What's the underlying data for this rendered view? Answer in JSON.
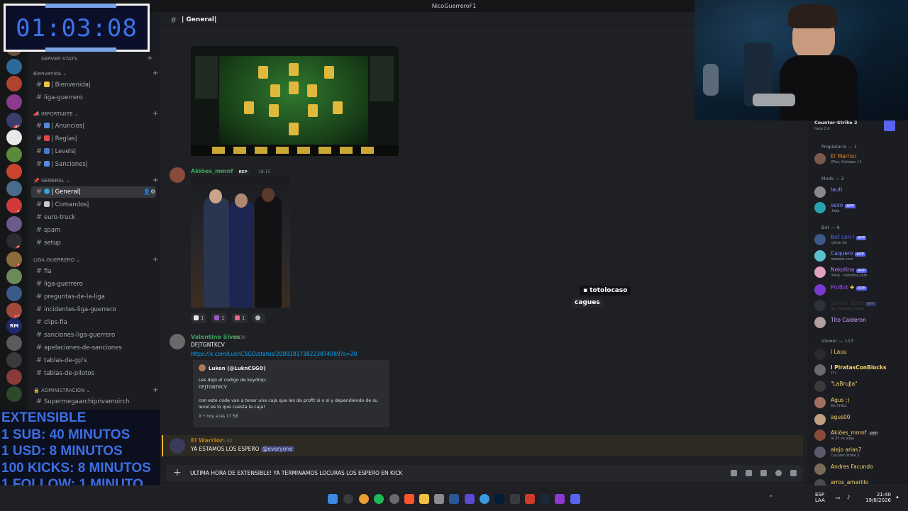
{
  "window_title": "NicoGuerreroF1",
  "timer": {
    "display": "01:03:08"
  },
  "extensible": {
    "lines": [
      "EXTENSIBLE",
      "1 SUB: 40 MINUTOS",
      "1 USD: 8 MINUTOS",
      "100 KICKS: 8 MINUTOS",
      "1 FOLLOW: 1 MINUTO"
    ]
  },
  "rail": {
    "badges": [
      "418",
      "59",
      "64",
      "31",
      "171"
    ],
    "rm_label": "RM"
  },
  "sidebar": {
    "server_stats": "SERVER STATS",
    "categories": {
      "bienvenida": "Bienvenida",
      "importante": "IMPORTANTE",
      "general": "GENERAL",
      "liga": "LIGA GUERRERO",
      "admin": "ADMINISTRACION"
    },
    "channels": {
      "bienvenida": "| Bienvenida|",
      "liga_guerrero": "liga-guerrero",
      "anuncios": "| Anuncios|",
      "reglas": "| Reglas|",
      "levels": "| Levels|",
      "sanciones": "| Sanciones|",
      "general": "| General|",
      "comandos": "| Comandos|",
      "euro_truck": "euro-truck",
      "spam": "spam",
      "setup": "setup",
      "fia": "fia",
      "liga_guerrero2": "liga-guerrero",
      "preguntas": "preguntas-de-la-liga",
      "incidentes": "incidentes-liga-guerrero",
      "clips": "clips-fia",
      "sanciones_liga": "sanciones-liga-guerrero",
      "apelaciones": "apelaciones-de-sanciones",
      "tablas_gp": "tablas-de-gp's",
      "tablas_pilotos": "tablas-de-pilotos",
      "super": "Supermegaarchiprivamoirch"
    }
  },
  "chat": {
    "header_title": "| General|",
    "messages": [
      {
        "author": "Akiões_mmnf",
        "badge": "REP",
        "time": "18:15",
        "author_color": "#3ba55c"
      },
      {
        "author": "Valentino Sives",
        "time": "18:30",
        "text": "DFJTGNTKCV",
        "author_color": "#3ba55c"
      },
      {
        "author": "El Warrior",
        "time": "21:32",
        "text": "YA ESTAMOS LOS ESPERO",
        "mention": "@everyone",
        "author_color": "#c27c0e"
      }
    ],
    "reactions": [
      "1",
      "1",
      "1"
    ],
    "link": "https://x.com/LuknCSGO/status/2090181738223874089?s=20",
    "embed": {
      "author": "Luken (@LuknCSGO)",
      "description": "Les dejo el codigo de keydrop:\nDFJTGNTKCV\n\ncon este code van a tener una caja que les da profit si o si y dependiendo de su level es lo que cuesta la caja!",
      "footer": "X • hoy a las 17:58"
    },
    "popup": {
      "name": "totolocaso",
      "message": "cagues"
    },
    "composer_text": "ULTIMA HORA DE EXTENSIBLE! YA TERMINAMOS LOCURAS LOS ESPERO EN KICK"
  },
  "members": {
    "activity_top": {
      "title": "Counter-Strike 2",
      "sub": "hace 2 d"
    },
    "groups": [
      {
        "label": "Propietario — 1"
      },
      {
        "label": "Mods — 2"
      },
      {
        "label": "Bot — 6"
      },
      {
        "label": "Viewer — 113"
      }
    ],
    "list": [
      {
        "name": "El Warrior",
        "sub": "2Pac, Outlawz +1",
        "color": "#e67e22"
      },
      {
        "name": "lauti",
        "color": "#7b8dfc"
      },
      {
        "name": "sexo",
        "sub": ".help",
        "color": "#7b8dfc",
        "app": "APP"
      },
      {
        "name": "Bot con l",
        "sub": "rythm.fm",
        "color": "#5865f2",
        "app": "APP"
      },
      {
        "name": "Caquero",
        "sub": "meebot.com",
        "color": "#7b8dfc",
        "app": "APP"
      },
      {
        "name": "Nekotina",
        "sub": "!help · nekotina.com",
        "color": "#ba7bfc",
        "app": "APP"
      },
      {
        "name": "ProBot",
        "color": "#a050fc",
        "app": "APP"
      },
      {
        "name": "Server Stats",
        "sub": "for changes | /help",
        "color": "#5c6470",
        "app": "APP"
      },
      {
        "name": "Tito Calderon",
        "color": "#d0a6fc"
      },
      {
        "name": "l Lauu",
        "color": "#f7d36e"
      },
      {
        "name": "l PiratasConBlocks",
        "sub": "???",
        "color": "#f7d36e"
      },
      {
        "name": "\"LaBruJJa\"",
        "color": "#f7d36e"
      },
      {
        "name": "Agus ;)",
        "sub": "De CHILL",
        "color": "#f7d36e"
      },
      {
        "name": "agus00",
        "color": "#f7d36e"
      },
      {
        "name": "Akiões_mmnf",
        "sub": "la 33 se aleja",
        "color": "#f7d36e",
        "rep": "REP"
      },
      {
        "name": "alejo arias7",
        "sub": "Counter-Strike 2",
        "color": "#f7d36e"
      },
      {
        "name": "Andres Facundo",
        "color": "#f7d36e"
      },
      {
        "name": "arros_amarillo",
        "color": "#f7d36e"
      }
    ]
  },
  "taskbar": {
    "lang": "ESP",
    "lang2": "LAA",
    "time": "21:40",
    "date": "19/8/2026"
  }
}
